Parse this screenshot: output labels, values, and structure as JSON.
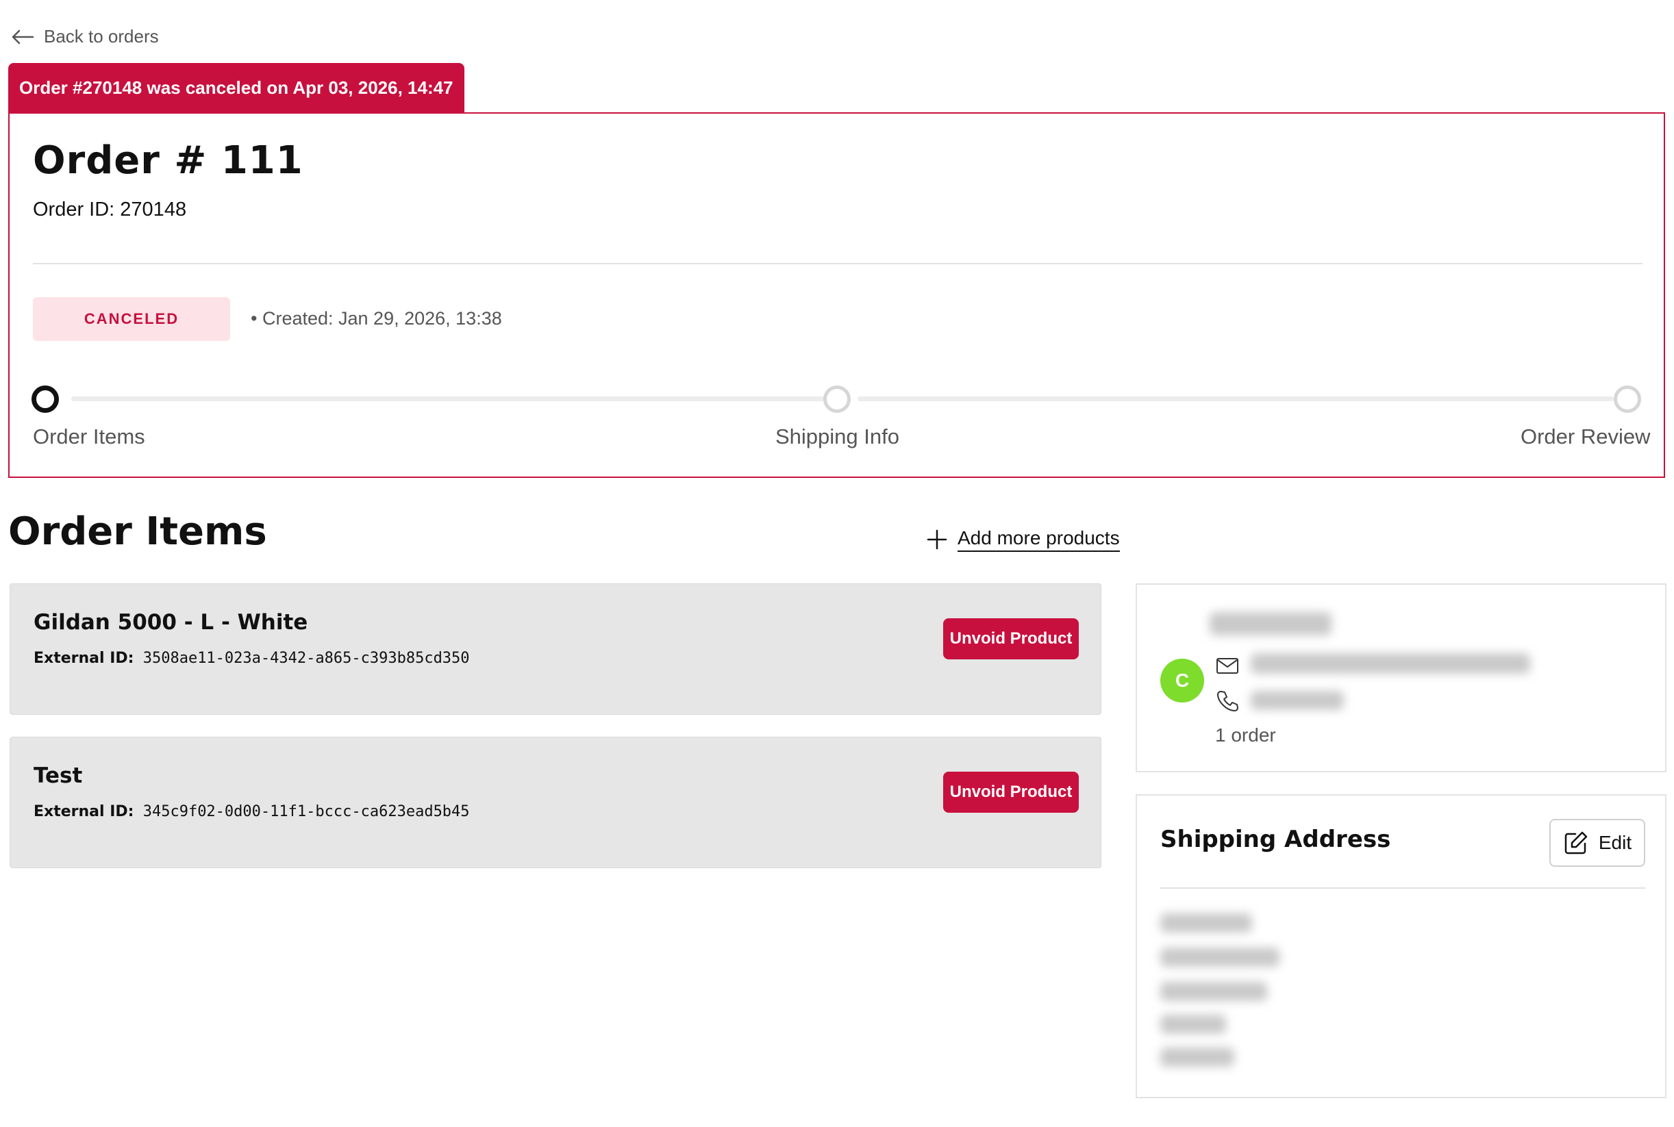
{
  "nav": {
    "back_label": "Back to orders"
  },
  "banner": {
    "text": "Order #270148 was canceled on Apr 03, 2026, 14:47"
  },
  "order": {
    "title": "Order # 111",
    "order_id": "Order ID: 270148",
    "status": "CANCELED",
    "created": "Created: Jan 29, 2026, 13:38"
  },
  "stepper": {
    "steps": [
      {
        "label": "Order Items",
        "active": true
      },
      {
        "label": "Shipping Info",
        "active": false
      },
      {
        "label": "Order Review",
        "active": false
      }
    ]
  },
  "items_section": {
    "title": "Order Items",
    "add_label": "Add more products",
    "ext_key": "External ID:",
    "items": [
      {
        "name": "Gildan 5000 - L - White",
        "external_id": "3508ae11-023a-4342-a865-c393b85cd350",
        "button": "Unvoid Product"
      },
      {
        "name": "Test",
        "external_id": "345c9f02-0d00-11f1-bccc-ca623ead5b45",
        "button": "Unvoid Product"
      }
    ]
  },
  "customer": {
    "avatar_letter": "C",
    "avatar_color": "#7ddc2c",
    "orders_count": "1 order"
  },
  "shipping": {
    "title": "Shipping Address",
    "edit_label": "Edit"
  },
  "colors": {
    "accent": "#c8103e",
    "badge_bg": "#fde3e7"
  }
}
